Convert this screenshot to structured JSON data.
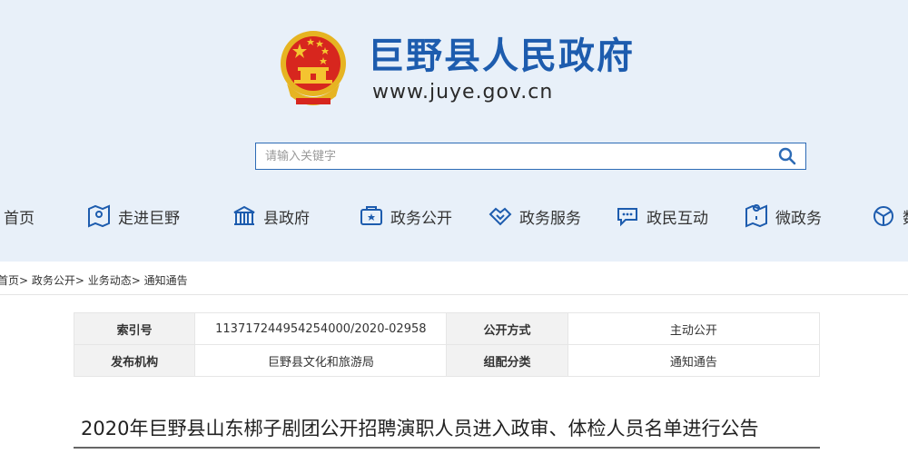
{
  "header": {
    "site_name": "巨野县人民政府",
    "site_url": "www.juye.gov.cn"
  },
  "search": {
    "placeholder": "请输入关键字"
  },
  "nav": {
    "items": [
      {
        "label": "首页",
        "icon": "home-icon"
      },
      {
        "label": "走进巨野",
        "icon": "map-icon"
      },
      {
        "label": "县政府",
        "icon": "building-icon"
      },
      {
        "label": "政务公开",
        "icon": "folder-icon"
      },
      {
        "label": "政务服务",
        "icon": "handshake-icon"
      },
      {
        "label": "政民互动",
        "icon": "chat-icon"
      },
      {
        "label": "微政务",
        "icon": "map-pin-icon"
      },
      {
        "label": "数",
        "icon": "globe-icon"
      }
    ]
  },
  "breadcrumb": "首页> 政务公开> 业务动态> 通知通告",
  "info": {
    "index_label": "索引号",
    "index_value": "113717244954254000/2020-02958",
    "method_label": "公开方式",
    "method_value": "主动公开",
    "org_label": "发布机构",
    "org_value": "巨野县文化和旅游局",
    "category_label": "组配分类",
    "category_value": "通知通告"
  },
  "article": {
    "title": "2020年巨野县山东梆子剧团公开招聘演职人员进入政审、体检人员名单进行公告"
  },
  "colors": {
    "brand": "#1d5cae",
    "header_bg": "#e8f0f9",
    "emblem_red": "#d7261e",
    "emblem_gold": "#f4c430"
  }
}
